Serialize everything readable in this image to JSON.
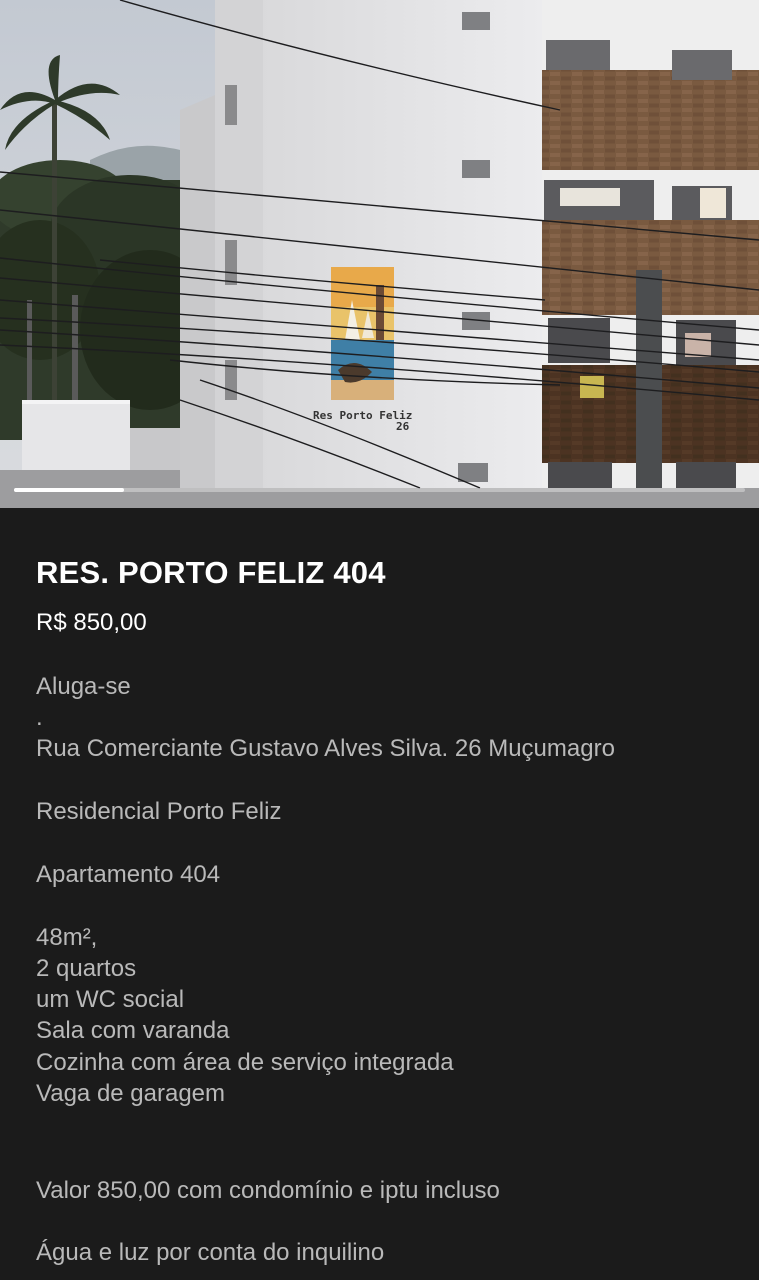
{
  "listing": {
    "title": "RES. PORTO FELIZ 404",
    "price": "R$ 850,00",
    "photo": {
      "sign_line1": "Res  Porto  Feliz",
      "sign_line2": "26",
      "gallery_progress": 0.15
    },
    "description": [
      "Aluga-se",
      ".",
      "Rua Comerciante Gustavo Alves Silva. 26 Muçumagro",
      "Residencial  Porto Feliz",
      "Apartamento 404",
      "48m²,",
      "2 quartos",
      "um WC social",
      "Sala com varanda",
      "Cozinha com área de serviço integrada",
      "Vaga de garagem",
      "Valor 850,00 com condomínio e iptu incluso",
      "Água e luz por conta do inquilino"
    ]
  },
  "colors": {
    "background": "#1b1b1b",
    "title": "#ffffff",
    "description": "#b9b9b9"
  }
}
